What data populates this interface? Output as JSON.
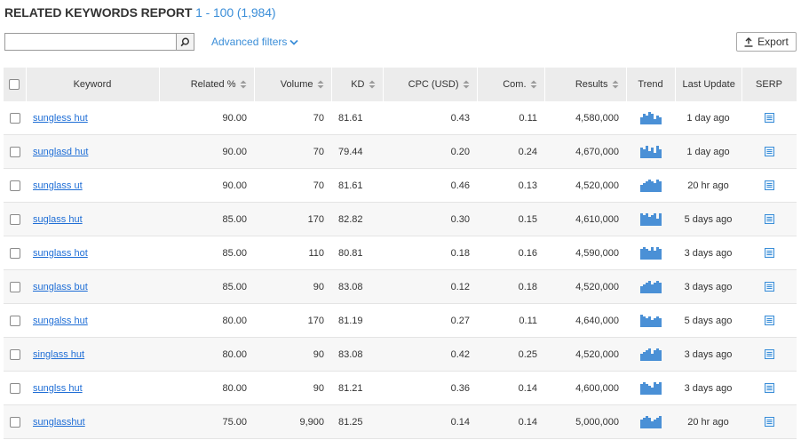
{
  "header": {
    "title": "RELATED KEYWORDS REPORT",
    "range": "1 - 100 (1,984)"
  },
  "search": {
    "value": "",
    "placeholder": ""
  },
  "filters": {
    "advanced_label": "Advanced filters"
  },
  "export": {
    "label": "Export"
  },
  "colors": {
    "accent": "#3b8ed8",
    "link": "#1f6ed6",
    "trend_bar": "#4a90d6",
    "header_bg": "#ececec"
  },
  "columns": {
    "keyword": "Keyword",
    "related": "Related %",
    "volume": "Volume",
    "kd": "KD",
    "cpc": "CPC (USD)",
    "com": "Com.",
    "results": "Results",
    "trend": "Trend",
    "last_update": "Last Update",
    "serp": "SERP"
  },
  "rows": [
    {
      "keyword": "sungless hut",
      "related": "90.00",
      "volume": "70",
      "kd": "81.61",
      "cpc": "0.43",
      "com": "0.11",
      "results": "4,580,000",
      "trend": [
        3,
        5,
        4,
        6,
        5,
        2,
        4,
        3
      ],
      "last_update": "1 day ago"
    },
    {
      "keyword": "sunglasd hut",
      "related": "90.00",
      "volume": "70",
      "kd": "79.44",
      "cpc": "0.20",
      "com": "0.24",
      "results": "4,670,000",
      "trend": [
        5,
        4,
        6,
        3,
        5,
        2,
        6,
        4
      ],
      "last_update": "1 day ago"
    },
    {
      "keyword": "sunglass ut",
      "related": "90.00",
      "volume": "70",
      "kd": "81.61",
      "cpc": "0.46",
      "com": "0.13",
      "results": "4,520,000",
      "trend": [
        3,
        4,
        5,
        6,
        5,
        4,
        6,
        5
      ],
      "last_update": "20 hr ago"
    },
    {
      "keyword": "suglass hut",
      "related": "85.00",
      "volume": "170",
      "kd": "82.82",
      "cpc": "0.30",
      "com": "0.15",
      "results": "4,610,000",
      "trend": [
        6,
        5,
        6,
        4,
        5,
        6,
        3,
        6
      ],
      "last_update": "5 days ago"
    },
    {
      "keyword": "sunglass hot",
      "related": "85.00",
      "volume": "110",
      "kd": "80.81",
      "cpc": "0.18",
      "com": "0.16",
      "results": "4,590,000",
      "trend": [
        5,
        6,
        5,
        4,
        6,
        4,
        6,
        5
      ],
      "last_update": "3 days ago"
    },
    {
      "keyword": "sunglass but",
      "related": "85.00",
      "volume": "90",
      "kd": "83.08",
      "cpc": "0.12",
      "com": "0.18",
      "results": "4,520,000",
      "trend": [
        3,
        4,
        5,
        6,
        4,
        5,
        6,
        5
      ],
      "last_update": "3 days ago"
    },
    {
      "keyword": "sungalss hut",
      "related": "80.00",
      "volume": "170",
      "kd": "81.19",
      "cpc": "0.27",
      "com": "0.11",
      "results": "4,640,000",
      "trend": [
        6,
        5,
        4,
        5,
        3,
        4,
        5,
        4
      ],
      "last_update": "5 days ago"
    },
    {
      "keyword": "singlass hut",
      "related": "80.00",
      "volume": "90",
      "kd": "83.08",
      "cpc": "0.42",
      "com": "0.25",
      "results": "4,520,000",
      "trend": [
        3,
        4,
        5,
        6,
        3,
        5,
        6,
        5
      ],
      "last_update": "3 days ago"
    },
    {
      "keyword": "sunglss hut",
      "related": "80.00",
      "volume": "90",
      "kd": "81.21",
      "cpc": "0.36",
      "com": "0.14",
      "results": "4,600,000",
      "trend": [
        5,
        6,
        5,
        4,
        3,
        6,
        5,
        6
      ],
      "last_update": "3 days ago"
    },
    {
      "keyword": "sunglasshut",
      "related": "75.00",
      "volume": "9,900",
      "kd": "81.25",
      "cpc": "0.14",
      "com": "0.14",
      "results": "5,000,000",
      "trend": [
        4,
        5,
        6,
        5,
        3,
        4,
        5,
        6
      ],
      "last_update": "20 hr ago"
    }
  ]
}
